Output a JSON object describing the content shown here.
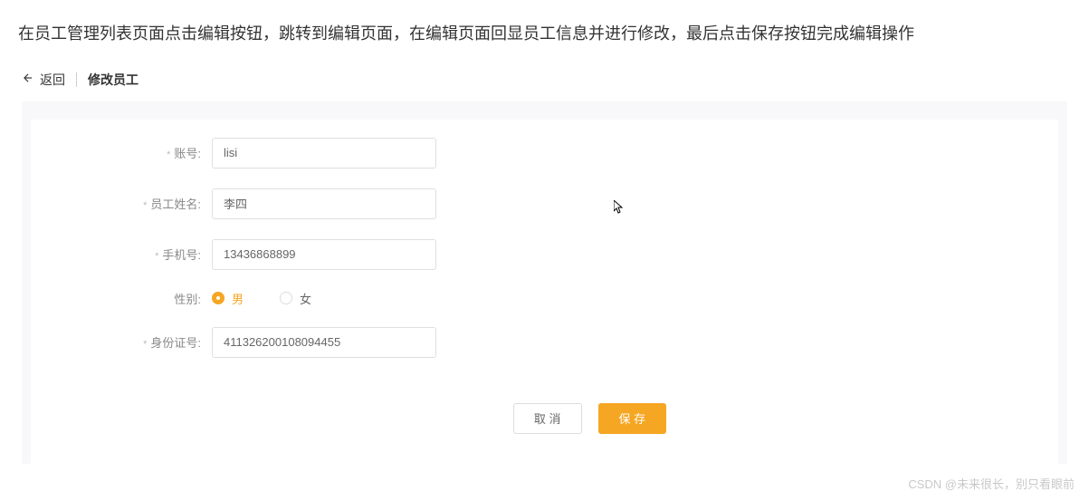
{
  "description": "在员工管理列表页面点击编辑按钮，跳转到编辑页面，在编辑页面回显员工信息并进行修改，最后点击保存按钮完成编辑操作",
  "header": {
    "back_label": "返回",
    "title": "修改员工"
  },
  "form": {
    "account": {
      "label": "账号:",
      "value": "lisi"
    },
    "name": {
      "label": "员工姓名:",
      "value": "李四"
    },
    "phone": {
      "label": "手机号:",
      "value": "13436868899"
    },
    "gender": {
      "label": "性别:",
      "options": {
        "male": "男",
        "female": "女"
      },
      "selected": "male"
    },
    "idcard": {
      "label": "身份证号:",
      "value": "411326200108094455"
    }
  },
  "buttons": {
    "cancel": "取 消",
    "save": "保 存"
  },
  "watermark": "CSDN @未来很长，别只看眼前"
}
